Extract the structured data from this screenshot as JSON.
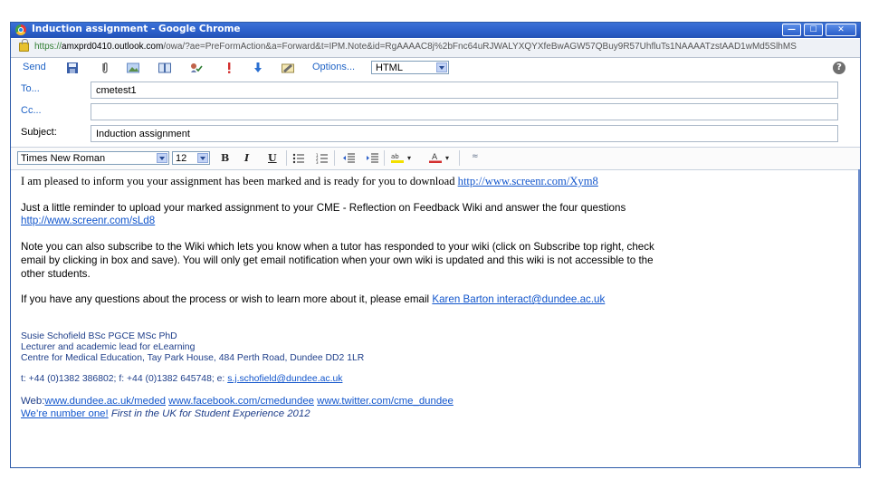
{
  "window": {
    "title": "Induction assignment - Google Chrome",
    "url_scheme": "https://",
    "url_host": "amxprd0410.outlook.com",
    "url_path": "/owa/?ae=PreFormAction&a=Forward&t=IPM.Note&id=RgAAAAC8j%2bFnc64uRJWALYXQYXfeBwAGW57QBuy9R57UhfluTs1NAAAATzstAAD1wMd5SlhMS"
  },
  "toolbar": {
    "send_label": "Send",
    "options_label": "Options...",
    "format_value": "HTML",
    "help_label": "?"
  },
  "fields": {
    "to_label": "To...",
    "to_value": "cmetest1",
    "cc_label": "Cc...",
    "cc_value": "",
    "subject_label": "Subject:",
    "subject_value": "Induction assignment"
  },
  "format": {
    "font_family": "Times New Roman",
    "font_size": "12",
    "bold": "B",
    "italic": "I",
    "underline": "U"
  },
  "message": {
    "line1_text": "I am pleased to inform you your assignment has been marked and is ready for you to download ",
    "line1_link": "http://www.screenr.com/Xym8",
    "line2_text": "Just a little reminder to upload your marked assignment to your CME - Reflection on Feedback Wiki and answer the four questions",
    "line2_link": "http://www.screenr.com/sLd8",
    "line3a": "Note you can also subscribe to the Wiki which lets you know when a tutor has responded to your wiki (click on Subscribe top right, check",
    "line3b": "email by clicking in box and save).  You will only get email notification when your own wiki is updated and this wiki is not accessible to the",
    "line3c": "other students.",
    "line4_text": "If you have any questions about the process or wish to learn more about it, please email ",
    "line4_link": "Karen Barton interact@dundee.ac.uk"
  },
  "signature": {
    "name": "Susie Schofield BSc PGCE MSc PhD",
    "role": "Lecturer and academic lead for eLearning",
    "address": "Centre for Medical Education, Tay Park House, 484 Perth Road, Dundee DD2 1LR",
    "contact_prefix": "t: +44 (0)1382 386802; f: +44 (0)1382 645748; e: ",
    "email": "s.j.schofield@dundee.ac.uk",
    "web_prefix": "Web:",
    "web_link": "www.dundee.ac.uk/meded",
    "facebook_link": "www.facebook.com/cmedundee",
    "twitter_link": "www.twitter.com/cme_dundee",
    "number_one": "We’re number one!",
    "tagline": "First in the UK for Student Experience 2012"
  }
}
